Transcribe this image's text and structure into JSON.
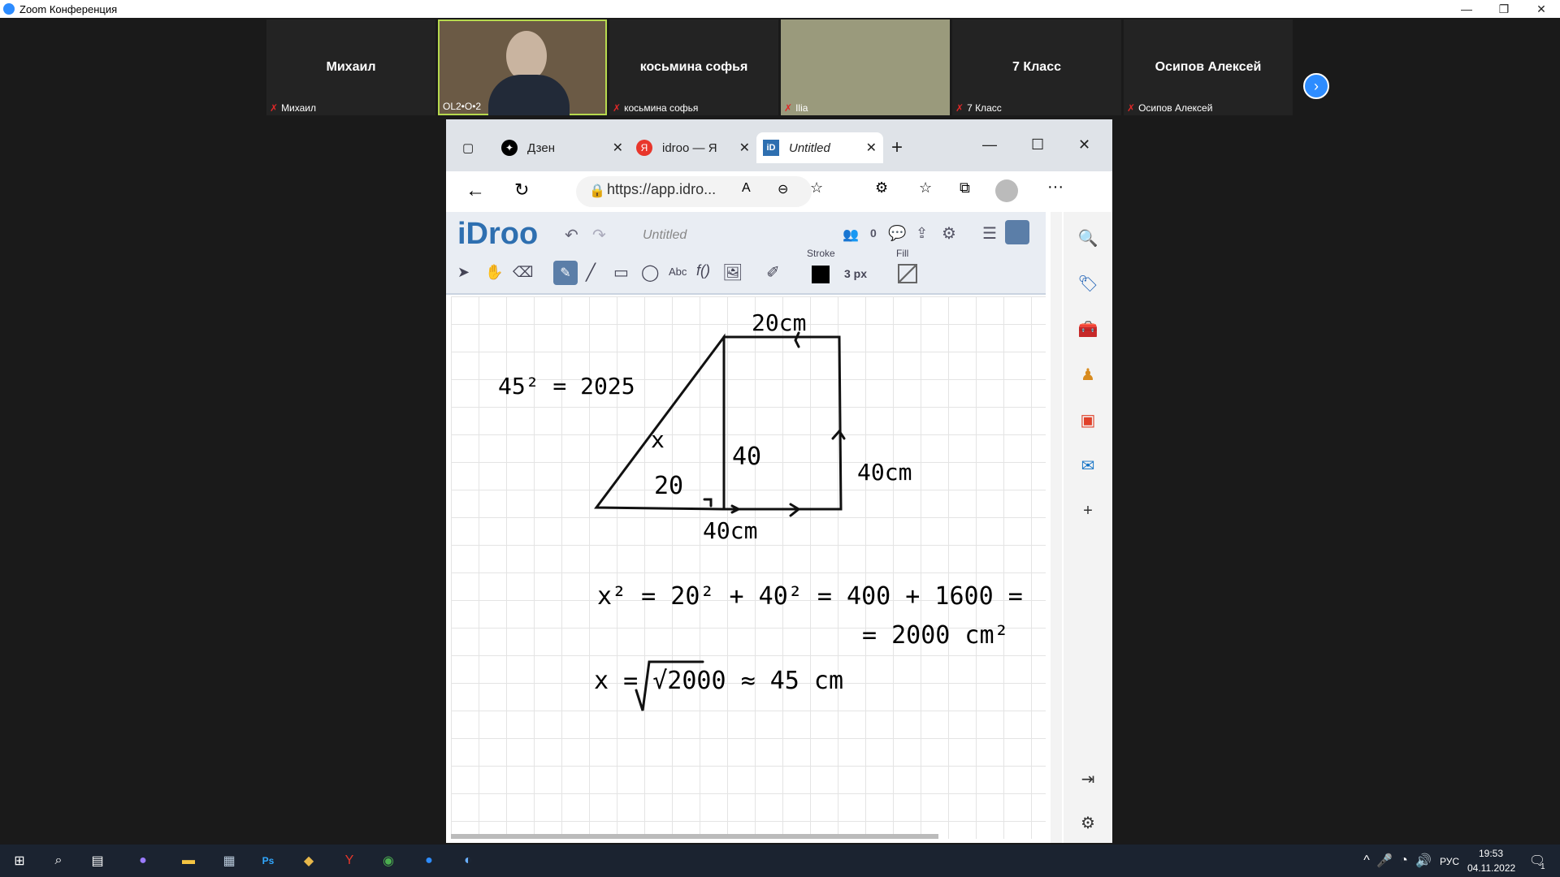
{
  "window": {
    "title": "Zoom Конференция"
  },
  "participants": [
    {
      "name": "Михаил",
      "label": "Михаил"
    },
    {
      "name": "",
      "label": "OL2•O•2"
    },
    {
      "name": "косьмина софья",
      "label": "косьмина софья"
    },
    {
      "name": "",
      "label": "Ilia"
    },
    {
      "name": "7 Класс",
      "label": "7 Класс"
    },
    {
      "name": "Осипов Алексей",
      "label": "Осипов Алексей"
    }
  ],
  "browser": {
    "tabs": [
      {
        "label": "Дзен"
      },
      {
        "label": "idroo — Я"
      },
      {
        "label": "Untitled"
      }
    ],
    "url": "https://app.idro..."
  },
  "app": {
    "logo": "iDroo",
    "doc_title": "Untitled",
    "users_count": "0",
    "stroke_label": "Stroke",
    "fill_label": "Fill",
    "stroke_width": "3 px",
    "stroke_color": "#000000"
  },
  "drawing": {
    "top_label": "20cm",
    "eq1": "45² = 2025",
    "x_label": "x",
    "inner_40": "40",
    "right_label": "40cm",
    "inner_20": "20",
    "bottom_label": "40cm",
    "eq2": "x² = 20² + 40² = 400 + 1600 =",
    "eq2b": "= 2000 cm²",
    "eq3": "x = √2000 ≈ 45 cm"
  },
  "taskbar": {
    "lang": "РУС",
    "time": "19:53",
    "date": "04.11.2022",
    "notif": "1"
  }
}
